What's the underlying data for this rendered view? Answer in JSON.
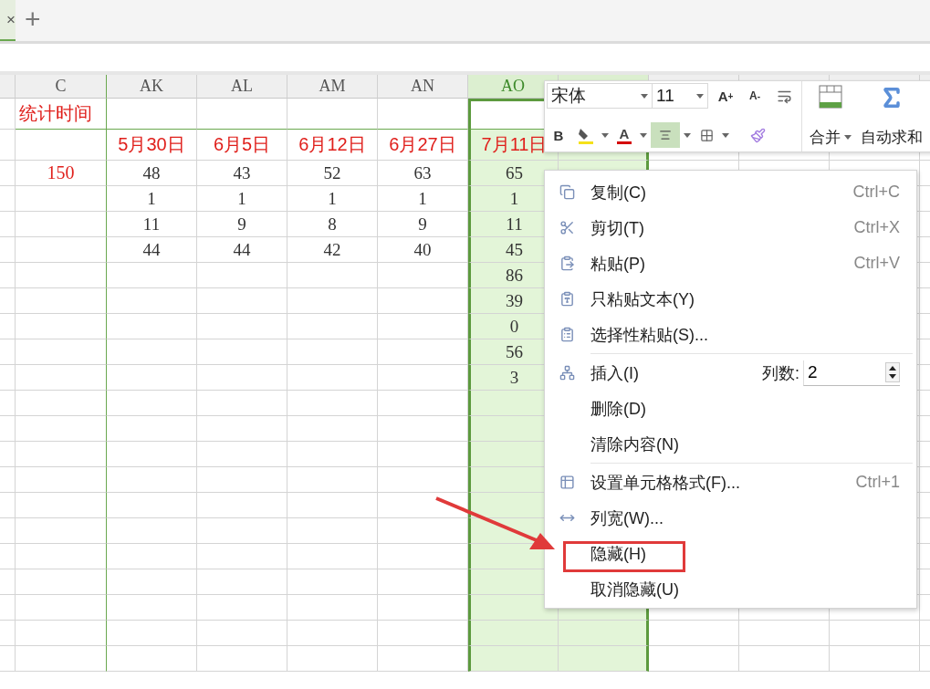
{
  "tabs": [
    {
      "close": "×",
      "selected": true
    }
  ],
  "new_tab": "+",
  "sheet": {
    "columns": [
      {
        "label": "C",
        "selected": false,
        "kind": "label"
      },
      {
        "label": "AK",
        "selected": false,
        "kind": "value"
      },
      {
        "label": "AL",
        "selected": false,
        "kind": "value"
      },
      {
        "label": "AM",
        "selected": false,
        "kind": "value"
      },
      {
        "label": "AN",
        "selected": false,
        "kind": "value"
      },
      {
        "label": "AO",
        "selected": true,
        "active": true,
        "kind": "value"
      },
      {
        "selected": true,
        "kind": "value"
      }
    ],
    "rows": [
      {
        "kind": "title",
        "active": true,
        "cells": [
          "统计时间"
        ]
      },
      {
        "kind": "date",
        "cells": [
          null,
          "5月30日",
          "6月5日",
          "6月12日",
          "6月27日",
          "7月11日"
        ]
      },
      {
        "kind": "data",
        "cells": [
          "150",
          "48",
          "43",
          "52",
          "63",
          "65"
        ]
      },
      {
        "kind": "data",
        "cells": [
          null,
          "1",
          "1",
          "1",
          "1",
          "1"
        ]
      },
      {
        "kind": "data",
        "cells": [
          null,
          "11",
          "9",
          "8",
          "9",
          "11"
        ]
      },
      {
        "kind": "data",
        "cells": [
          null,
          "44",
          "44",
          "42",
          "40",
          "45"
        ]
      },
      {
        "kind": "data",
        "cells": [
          null,
          null,
          null,
          null,
          null,
          "86"
        ]
      },
      {
        "kind": "data",
        "cells": [
          null,
          null,
          null,
          null,
          null,
          "39"
        ]
      },
      {
        "kind": "data",
        "cells": [
          null,
          null,
          null,
          null,
          null,
          "0"
        ]
      },
      {
        "kind": "data",
        "cells": [
          null,
          null,
          null,
          null,
          null,
          "56"
        ]
      },
      {
        "kind": "data",
        "cells": [
          null,
          null,
          null,
          null,
          null,
          "3"
        ]
      }
    ]
  },
  "mini_toolbar": {
    "font": "宋体",
    "size": "11",
    "top_tools": [
      {
        "kind": "grow",
        "text": "A",
        "sup": "+",
        "selected": false
      },
      {
        "kind": "shrink",
        "text": "A",
        "sup": "-",
        "selected": false
      },
      {
        "kind": "wrap",
        "selected": false
      }
    ],
    "bottom_tools": [
      {
        "kind": "bold",
        "text": "B",
        "selected": false
      },
      {
        "kind": "fill",
        "selected": false
      },
      {
        "kind": "font_color",
        "text": "A",
        "selected": false
      },
      {
        "kind": "align",
        "selected": true
      },
      {
        "kind": "borders",
        "selected": false
      },
      {
        "kind": "painter",
        "selected": false
      }
    ],
    "merge": "合并",
    "autosum": "自动求和"
  },
  "context_menu": [
    {
      "kind": "item",
      "label": "复制(C)",
      "shortcut": "Ctrl+C",
      "annotated": false
    },
    {
      "kind": "item",
      "label": "剪切(T)",
      "shortcut": "Ctrl+X",
      "annotated": false
    },
    {
      "kind": "item",
      "label": "粘贴(P)",
      "shortcut": "Ctrl+V",
      "annotated": false
    },
    {
      "kind": "item",
      "label": "只粘贴文本(Y)",
      "annotated": false
    },
    {
      "kind": "item",
      "label": "选择性粘贴(S)...",
      "annotated": false
    },
    {
      "kind": "separator"
    },
    {
      "kind": "spinner",
      "label": "插入(I)",
      "count_label": "列数:",
      "count": "2",
      "annotated": false
    },
    {
      "kind": "item",
      "label": "删除(D)",
      "annotated": false
    },
    {
      "kind": "item",
      "label": "清除内容(N)",
      "annotated": false
    },
    {
      "kind": "separator"
    },
    {
      "kind": "item",
      "label": "设置单元格格式(F)...",
      "shortcut": "Ctrl+1",
      "annotated": false
    },
    {
      "kind": "item",
      "label": "列宽(W)...",
      "annotated": false
    },
    {
      "kind": "item",
      "label": "隐藏(H)",
      "annotated": true
    },
    {
      "kind": "item",
      "label": "取消隐藏(U)",
      "annotated": false
    }
  ]
}
